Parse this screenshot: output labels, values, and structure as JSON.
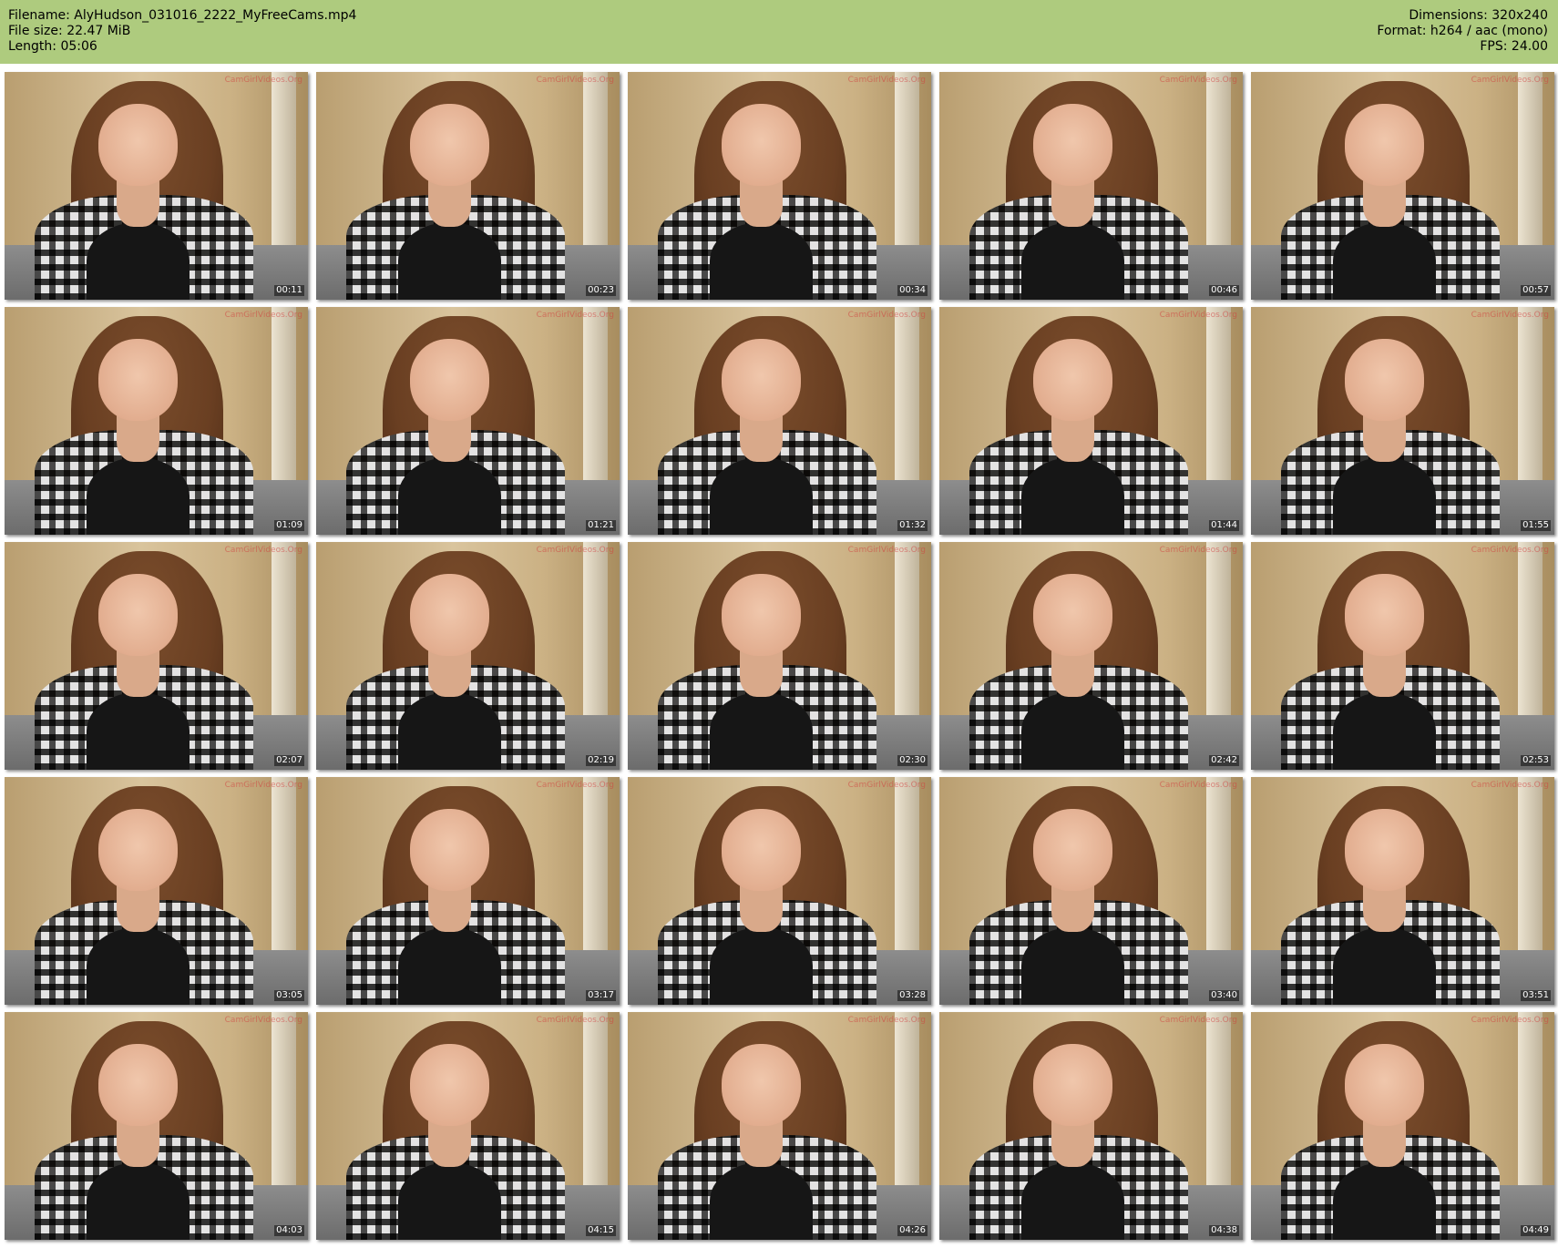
{
  "header": {
    "left": [
      "Filename: AlyHudson_031016_2222_MyFreeCams.mp4",
      "File size: 22.47 MiB",
      "Length: 05:06"
    ],
    "right": [
      "Dimensions: 320x240",
      "Format: h264 / aac (mono)",
      "FPS: 24.00"
    ]
  },
  "watermark": "CamGirlVideos.Org",
  "timestamps": [
    "00:11",
    "00:23",
    "00:34",
    "00:46",
    "00:57",
    "01:09",
    "01:21",
    "01:32",
    "01:44",
    "01:55",
    "02:07",
    "02:19",
    "02:30",
    "02:42",
    "02:53",
    "03:05",
    "03:17",
    "03:28",
    "03:40",
    "03:51",
    "04:03",
    "04:15",
    "04:26",
    "04:38",
    "04:49"
  ]
}
